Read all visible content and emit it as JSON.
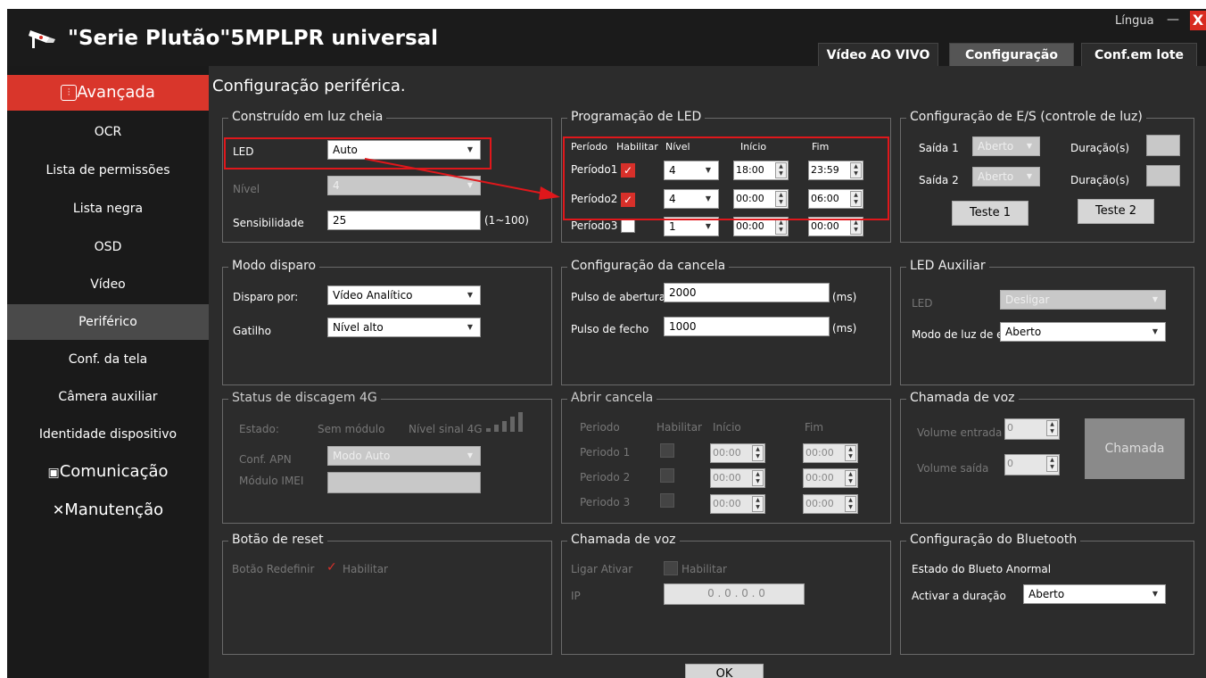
{
  "app": {
    "title": "\"Serie Plutão\"5MPLPR universal",
    "language_label": "Língua",
    "minimize": "—",
    "close": "X"
  },
  "tabs": [
    {
      "label": "Vídeo AO VIVO"
    },
    {
      "label": "Configuração"
    },
    {
      "label": "Conf.em lote"
    }
  ],
  "sidebar": {
    "items": [
      {
        "label": "Avançada",
        "icon": "equalizer-icon"
      },
      {
        "label": "OCR"
      },
      {
        "label": "Lista de permissões"
      },
      {
        "label": "Lista negra"
      },
      {
        "label": "OSD"
      },
      {
        "label": "Vídeo"
      },
      {
        "label": "Periférico"
      },
      {
        "label": "Conf. da tela"
      },
      {
        "label": "Câmera auxiliar"
      },
      {
        "label": "Identidade dispositivo"
      },
      {
        "label": "Comunicação",
        "icon": "camera-icon"
      },
      {
        "label": "Manutenção",
        "icon": "tools-icon"
      }
    ]
  },
  "page": {
    "title": "Configuração periférica."
  },
  "builtin_light": {
    "legend": "Construído em luz cheia",
    "led_label": "LED",
    "led_value": "Auto",
    "level_label": "Nível",
    "level_value": "4",
    "sens_label": "Sensibilidade",
    "sens_value": "25",
    "sens_range": "(1~100)"
  },
  "led_schedule": {
    "legend": "Programação de LED",
    "headers": {
      "period": "Período",
      "enable": "Habilitar",
      "level": "Nível",
      "start": "Início",
      "end": "Fim"
    },
    "rows": [
      {
        "label": "Período1",
        "enabled": true,
        "level": "4",
        "start": "18:00",
        "end": "23:59"
      },
      {
        "label": "Período2",
        "enabled": true,
        "level": "4",
        "start": "00:00",
        "end": "06:00"
      },
      {
        "label": "Período3",
        "enabled": false,
        "level": "1",
        "start": "00:00",
        "end": "00:00"
      }
    ]
  },
  "io_config": {
    "legend": "Configuração de E/S (controle de luz)",
    "out1_label": "Saída 1",
    "out1_value": "Aberto",
    "dur1_label": "Duração(s)",
    "out2_label": "Saída 2",
    "out2_value": "Aberto",
    "dur2_label": "Duração(s)",
    "test1": "Teste 1",
    "test2": "Teste 2"
  },
  "trigger_mode": {
    "legend": "Modo disparo",
    "by_label": "Disparo por:",
    "by_value": "Vídeo Analítico",
    "gat_label": "Gatilho",
    "gat_value": "Nível alto"
  },
  "barrier_config": {
    "legend": "Configuração da cancela",
    "open_label": "Pulso de abertura",
    "open_value": "2000",
    "open_unit": "(ms)",
    "close_label": "Pulso de fecho",
    "close_value": "1000",
    "close_unit": "(ms)"
  },
  "aux_led": {
    "legend": "LED Auxiliar",
    "led_label": "LED",
    "led_value": "Desligar",
    "mode_label": "Modo de luz de e",
    "mode_value": "Aberto"
  },
  "dial4g": {
    "legend": "Status de discagem 4G",
    "state_label": "Estado:",
    "state_value": "Sem módulo",
    "signal_label": "Nível sinal 4G",
    "apn_label": "Conf. APN",
    "apn_value": "Modo Auto",
    "imei_label": "Módulo IMEI"
  },
  "open_barrier": {
    "legend": "Abrir cancela",
    "headers": {
      "period": "Periodo",
      "enable": "Habilitar",
      "start": "Início",
      "end": "Fim"
    },
    "rows": [
      {
        "label": "Periodo 1",
        "start": "00:00",
        "end": "00:00"
      },
      {
        "label": "Periodo 2",
        "start": "00:00",
        "end": "00:00"
      },
      {
        "label": "Periodo 3",
        "start": "00:00",
        "end": "00:00"
      }
    ]
  },
  "voice_call_right": {
    "legend": "Chamada de voz",
    "vin_label": "Volume entrada",
    "vin_value": "0",
    "vout_label": "Volume saída",
    "vout_value": "0",
    "call_button": "Chamada"
  },
  "reset_button": {
    "legend": "Botão de reset",
    "label": "Botão Redefinir",
    "enable": "Habilitar"
  },
  "voice_call_mid": {
    "legend": "Chamada de voz",
    "on_label": "Ligar Ativar",
    "enable": "Habilitar",
    "ip_label": "IP",
    "ip_value": "0 . 0 . 0 . 0"
  },
  "bluetooth": {
    "legend": "Configuração do Bluetooth",
    "state": "Estado do Blueto Anormal",
    "dur_label": "Activar a duração",
    "dur_value": "Aberto"
  },
  "ok_button": "OK"
}
